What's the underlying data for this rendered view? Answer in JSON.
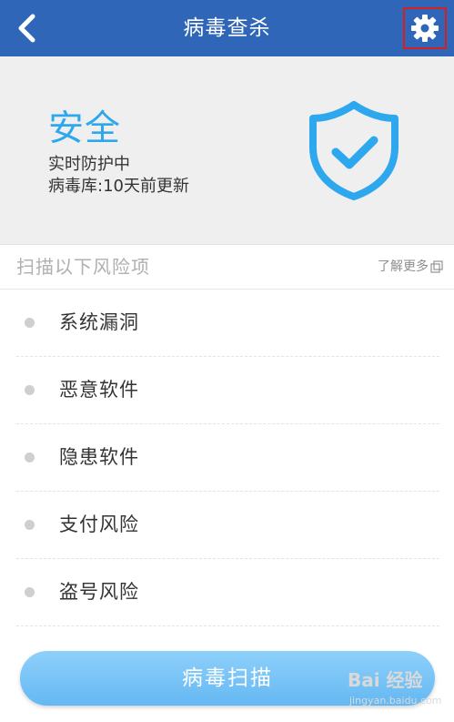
{
  "header": {
    "back_icon": "chevron-left-icon",
    "title": "病毒查杀",
    "settings_icon": "gear-icon"
  },
  "status": {
    "title": "安全",
    "lines": [
      "实时防护中",
      "病毒库:10天前更新"
    ],
    "shield_icon": "shield-check-icon",
    "accent_color": "#2da7ee"
  },
  "scan_section": {
    "title": "扫描以下风险项",
    "learn_more": "了解更多",
    "items": [
      {
        "label": "系统漏洞"
      },
      {
        "label": "恶意软件"
      },
      {
        "label": "隐患软件"
      },
      {
        "label": "支付风险"
      },
      {
        "label": "盗号风险"
      }
    ]
  },
  "scan_button": {
    "label": "病毒扫描"
  },
  "watermark": {
    "brand": "Bai 经验",
    "domain": "jingyan.baidu.com"
  }
}
